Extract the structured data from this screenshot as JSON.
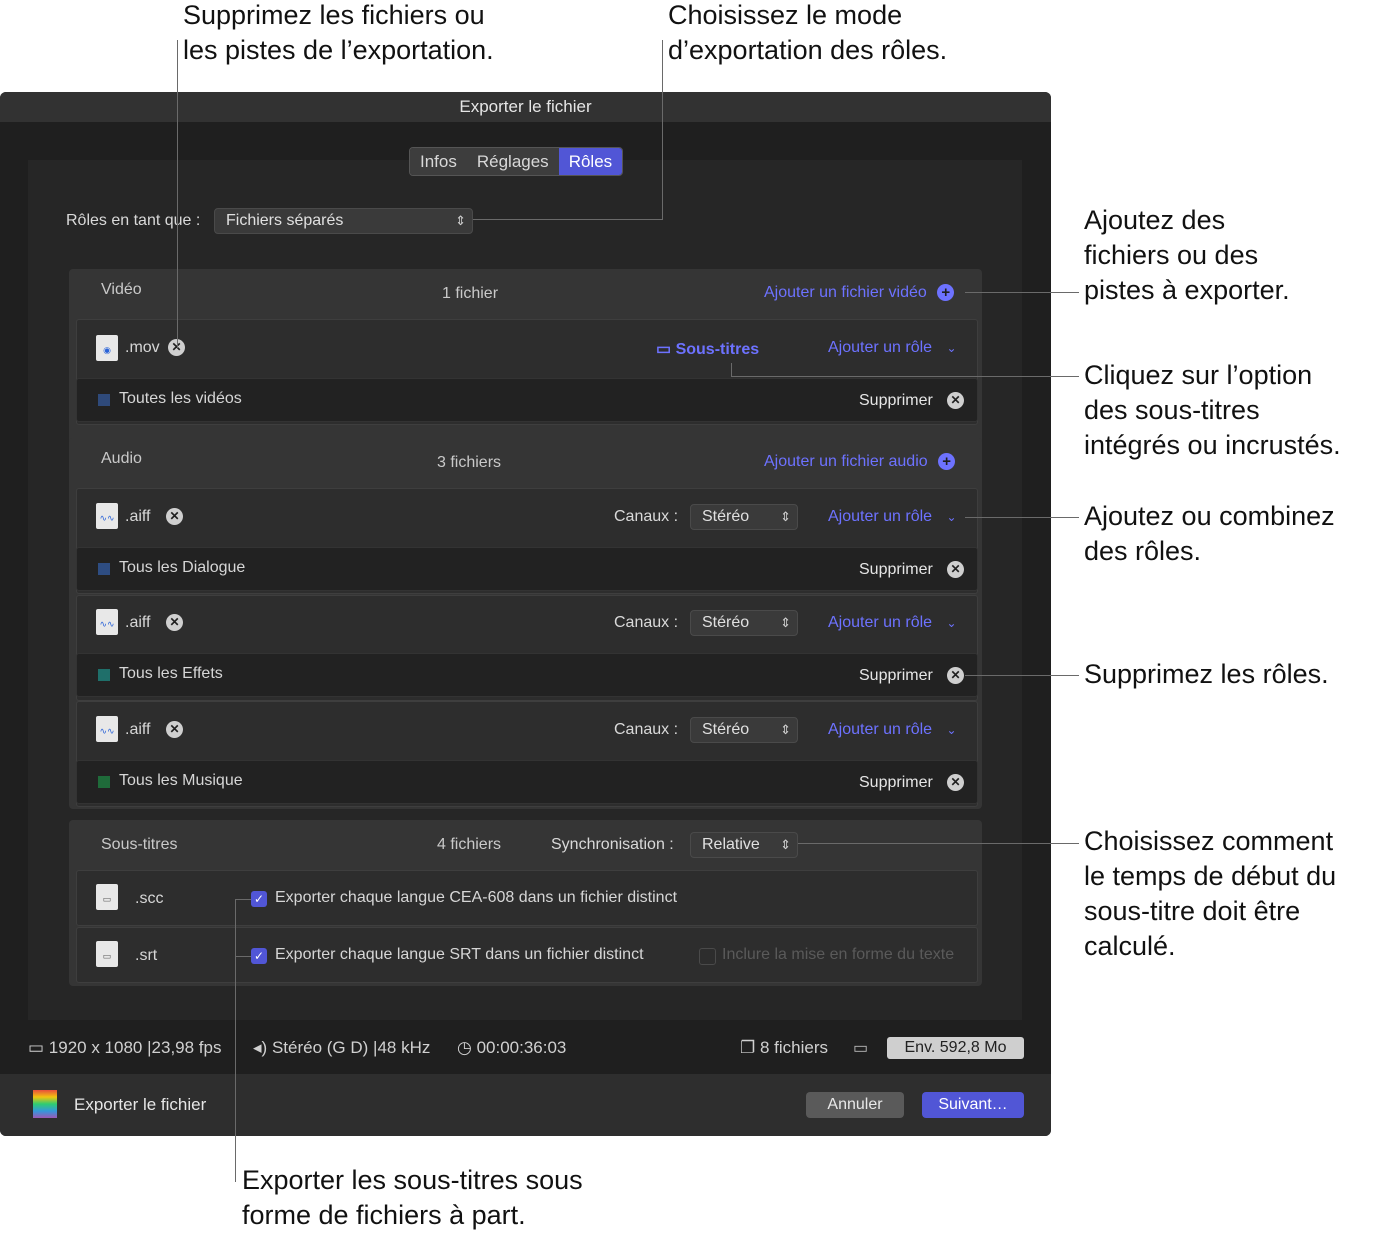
{
  "callouts": {
    "remove_files": "Supprimez les fichiers ou\nles pistes de l’exportation.",
    "roles_mode": "Choisissez le mode\nd’exportation des rôles.",
    "add_files": "Ajoutez des\nfichiers ou des\npistes à exporter.",
    "captions_option": "Cliquez sur l’option\ndes sous-titres\nintégrés ou incrustés.",
    "add_roles": "Ajoutez ou combinez\ndes rôles.",
    "delete_roles": "Supprimez les rôles.",
    "start_time": "Choisissez comment\nle temps de début du\nsous-titre doit être\ncalculé.",
    "export_separate": "Exporter les sous-titres sous\nforme de fichiers à part."
  },
  "window": {
    "title": "Exporter le fichier",
    "tabs": [
      "Infos",
      "Réglages",
      "Rôles"
    ],
    "roles_as_label": "Rôles en tant que :",
    "roles_as_value": "Fichiers séparés"
  },
  "video": {
    "title": "Vidéo",
    "count": "1 fichier",
    "add_label": "Ajouter un fichier vidéo",
    "file": {
      "ext": ".mov",
      "captions": "Sous-titres",
      "add_role": "Ajouter un rôle"
    },
    "role": {
      "name": "Toutes les vidéos",
      "remove": "Supprimer",
      "color": "#2f4a7a"
    }
  },
  "audio": {
    "title": "Audio",
    "count": "3 fichiers",
    "add_label": "Ajouter un fichier audio",
    "channels_label": "Canaux :",
    "files": [
      {
        "ext": ".aiff",
        "channels": "Stéréo",
        "add_role": "Ajouter un rôle",
        "role": "Tous les Dialogue",
        "remove": "Supprimer",
        "color": "#2e4d82"
      },
      {
        "ext": ".aiff",
        "channels": "Stéréo",
        "add_role": "Ajouter un rôle",
        "role": "Tous les Effets",
        "remove": "Supprimer",
        "color": "#1f6f6a"
      },
      {
        "ext": ".aiff",
        "channels": "Stéréo",
        "add_role": "Ajouter un rôle",
        "role": "Tous les Musique",
        "remove": "Supprimer",
        "color": "#1f6b3a"
      }
    ]
  },
  "subtitles": {
    "title": "Sous-titres",
    "count": "4 fichiers",
    "sync_label": "Synchronisation :",
    "sync_value": "Relative",
    "scc": {
      "ext": ".scc",
      "option": "Exporter chaque langue CEA-608 dans un fichier distinct"
    },
    "srt": {
      "ext": ".srt",
      "option": "Exporter chaque langue SRT dans un fichier distinct",
      "format_option": "Inclure la mise en forme du texte"
    }
  },
  "status": {
    "resolution": "1920 x 1080",
    "fps": "23,98 fps",
    "audio": "Stéréo (G D)",
    "rate": "48 kHz",
    "duration": "00:00:36:03",
    "files": "8 fichiers",
    "size": "Env. 592,8 Mo"
  },
  "footer": {
    "title": "Exporter le fichier",
    "cancel": "Annuler",
    "next": "Suivant…"
  },
  "icons": [
    "quicktime-icon",
    "audio-file-icon",
    "caption-file-icon",
    "remove-icon",
    "add-icon",
    "captions-icon",
    "chevron-down-icon",
    "display-icon",
    "clock-icon",
    "speaker-icon",
    "frame-icon",
    "files-icon",
    "film-icon"
  ]
}
